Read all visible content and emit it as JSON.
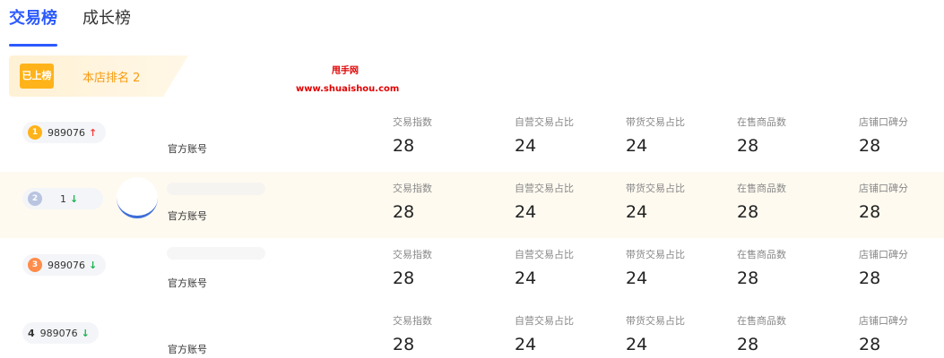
{
  "tabs": [
    {
      "label": "交易榜",
      "active": true
    },
    {
      "label": "成长榜",
      "active": false
    }
  ],
  "rank_banner": {
    "pill": "已上榜",
    "text": "本店排名 2"
  },
  "watermark": {
    "line1": "甩手网",
    "line2": "www.shuaishou.com"
  },
  "stat_labels": [
    "交易指数",
    "自营交易占比",
    "带货交易占比",
    "在售商品数",
    "店铺口碑分"
  ],
  "rows": [
    {
      "medal": "1",
      "medal_style": "gold",
      "score": "989076",
      "trend": "up",
      "account_label": "官方账号",
      "values": [
        "28",
        "24",
        "24",
        "28",
        "28"
      ]
    },
    {
      "medal": "2",
      "medal_style": "silver",
      "score": "1",
      "trend": "down",
      "account_label": "官方账号",
      "values": [
        "28",
        "24",
        "24",
        "28",
        "28"
      ]
    },
    {
      "medal": "3",
      "medal_style": "bronze",
      "score": "989076",
      "trend": "down",
      "account_label": "官方账号",
      "values": [
        "28",
        "24",
        "24",
        "28",
        "28"
      ]
    },
    {
      "medal": "4",
      "medal_style": "plain",
      "score": "989076",
      "trend": "down",
      "account_label": "官方账号",
      "values": [
        "28",
        "24",
        "24",
        "28",
        "28"
      ]
    }
  ],
  "icons": {
    "trend_up": "↑",
    "trend_down": "↓"
  }
}
